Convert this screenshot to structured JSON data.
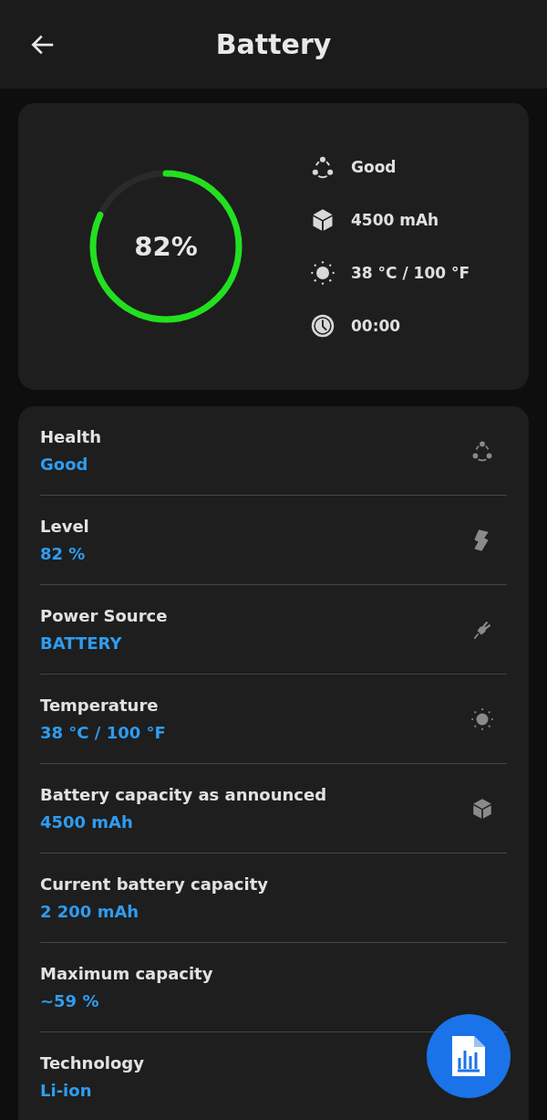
{
  "header": {
    "title": "Battery"
  },
  "summary": {
    "level": 0.82,
    "percent": "82%",
    "stats": [
      "Good",
      "4500 mAh",
      "38 °C / 100 °F",
      "00:00"
    ]
  },
  "details": [
    {
      "label": "Health",
      "value": "Good"
    },
    {
      "label": "Level",
      "value": "82 %"
    },
    {
      "label": "Power Source",
      "value": "BATTERY"
    },
    {
      "label": "Temperature",
      "value": "38 °C / 100 °F"
    },
    {
      "label": "Battery capacity as announced",
      "value": "4500 mAh"
    },
    {
      "label": "Current battery capacity",
      "value": "2 200 mAh"
    },
    {
      "label": "Maximum capacity",
      "value": "~59 %"
    },
    {
      "label": "Technology",
      "value": "Li-ion"
    }
  ]
}
